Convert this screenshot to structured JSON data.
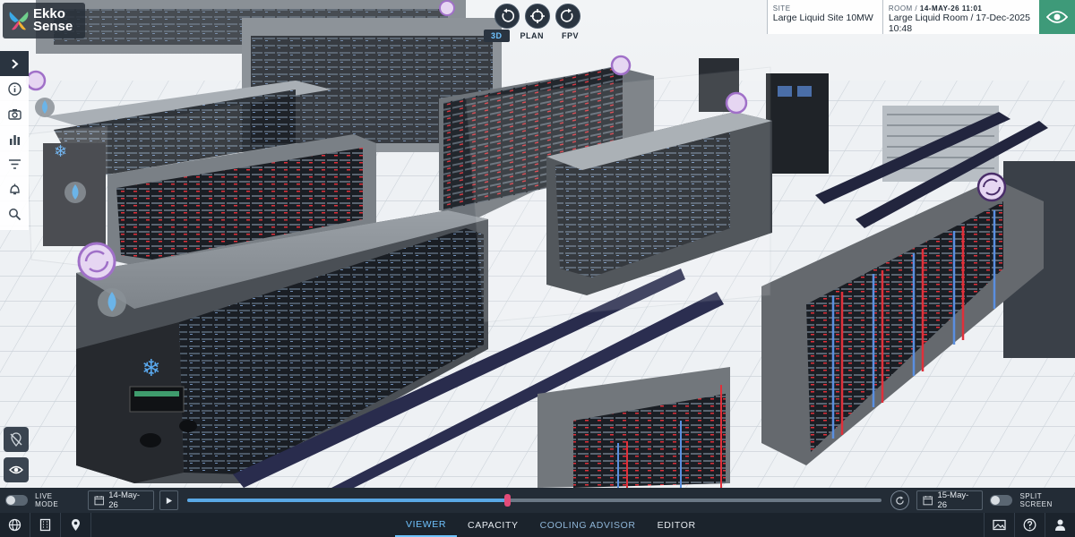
{
  "logo": {
    "line1": "Ekko",
    "line2": "Sense"
  },
  "view_modes": {
    "mode_3d": "3D",
    "plan": "PLAN",
    "fpv": "FPV"
  },
  "info": {
    "site_caption": "SITE",
    "site_value": "Large Liquid Site 10MW",
    "room_caption": "ROOM / ",
    "room_date": "14-MAY-26 11:01",
    "room_value": "Large Liquid Room / 17-Dec-2025",
    "room_time": "10:48"
  },
  "left_toolbar": [
    "chevron-right-icon",
    "info-icon",
    "camera-icon",
    "bar-chart-icon",
    "filter-icon",
    "bell-icon",
    "search-icon"
  ],
  "timeline": {
    "live_mode_label": "LIVE MODE",
    "start_date": "14-May-26",
    "end_date": "15-May-26",
    "split_label": "SPLIT SCREEN",
    "progress": 0.46
  },
  "tabs": [
    "VIEWER",
    "CAPACITY",
    "COOLING ADVISOR",
    "EDITOR"
  ],
  "colors": {
    "accent": "#6fc3ff",
    "eye_button": "#3e9a79",
    "hot_pipe": "#e0303a",
    "cold_pipe": "#5a8fe0",
    "advisor_marker": "#a070c8"
  }
}
